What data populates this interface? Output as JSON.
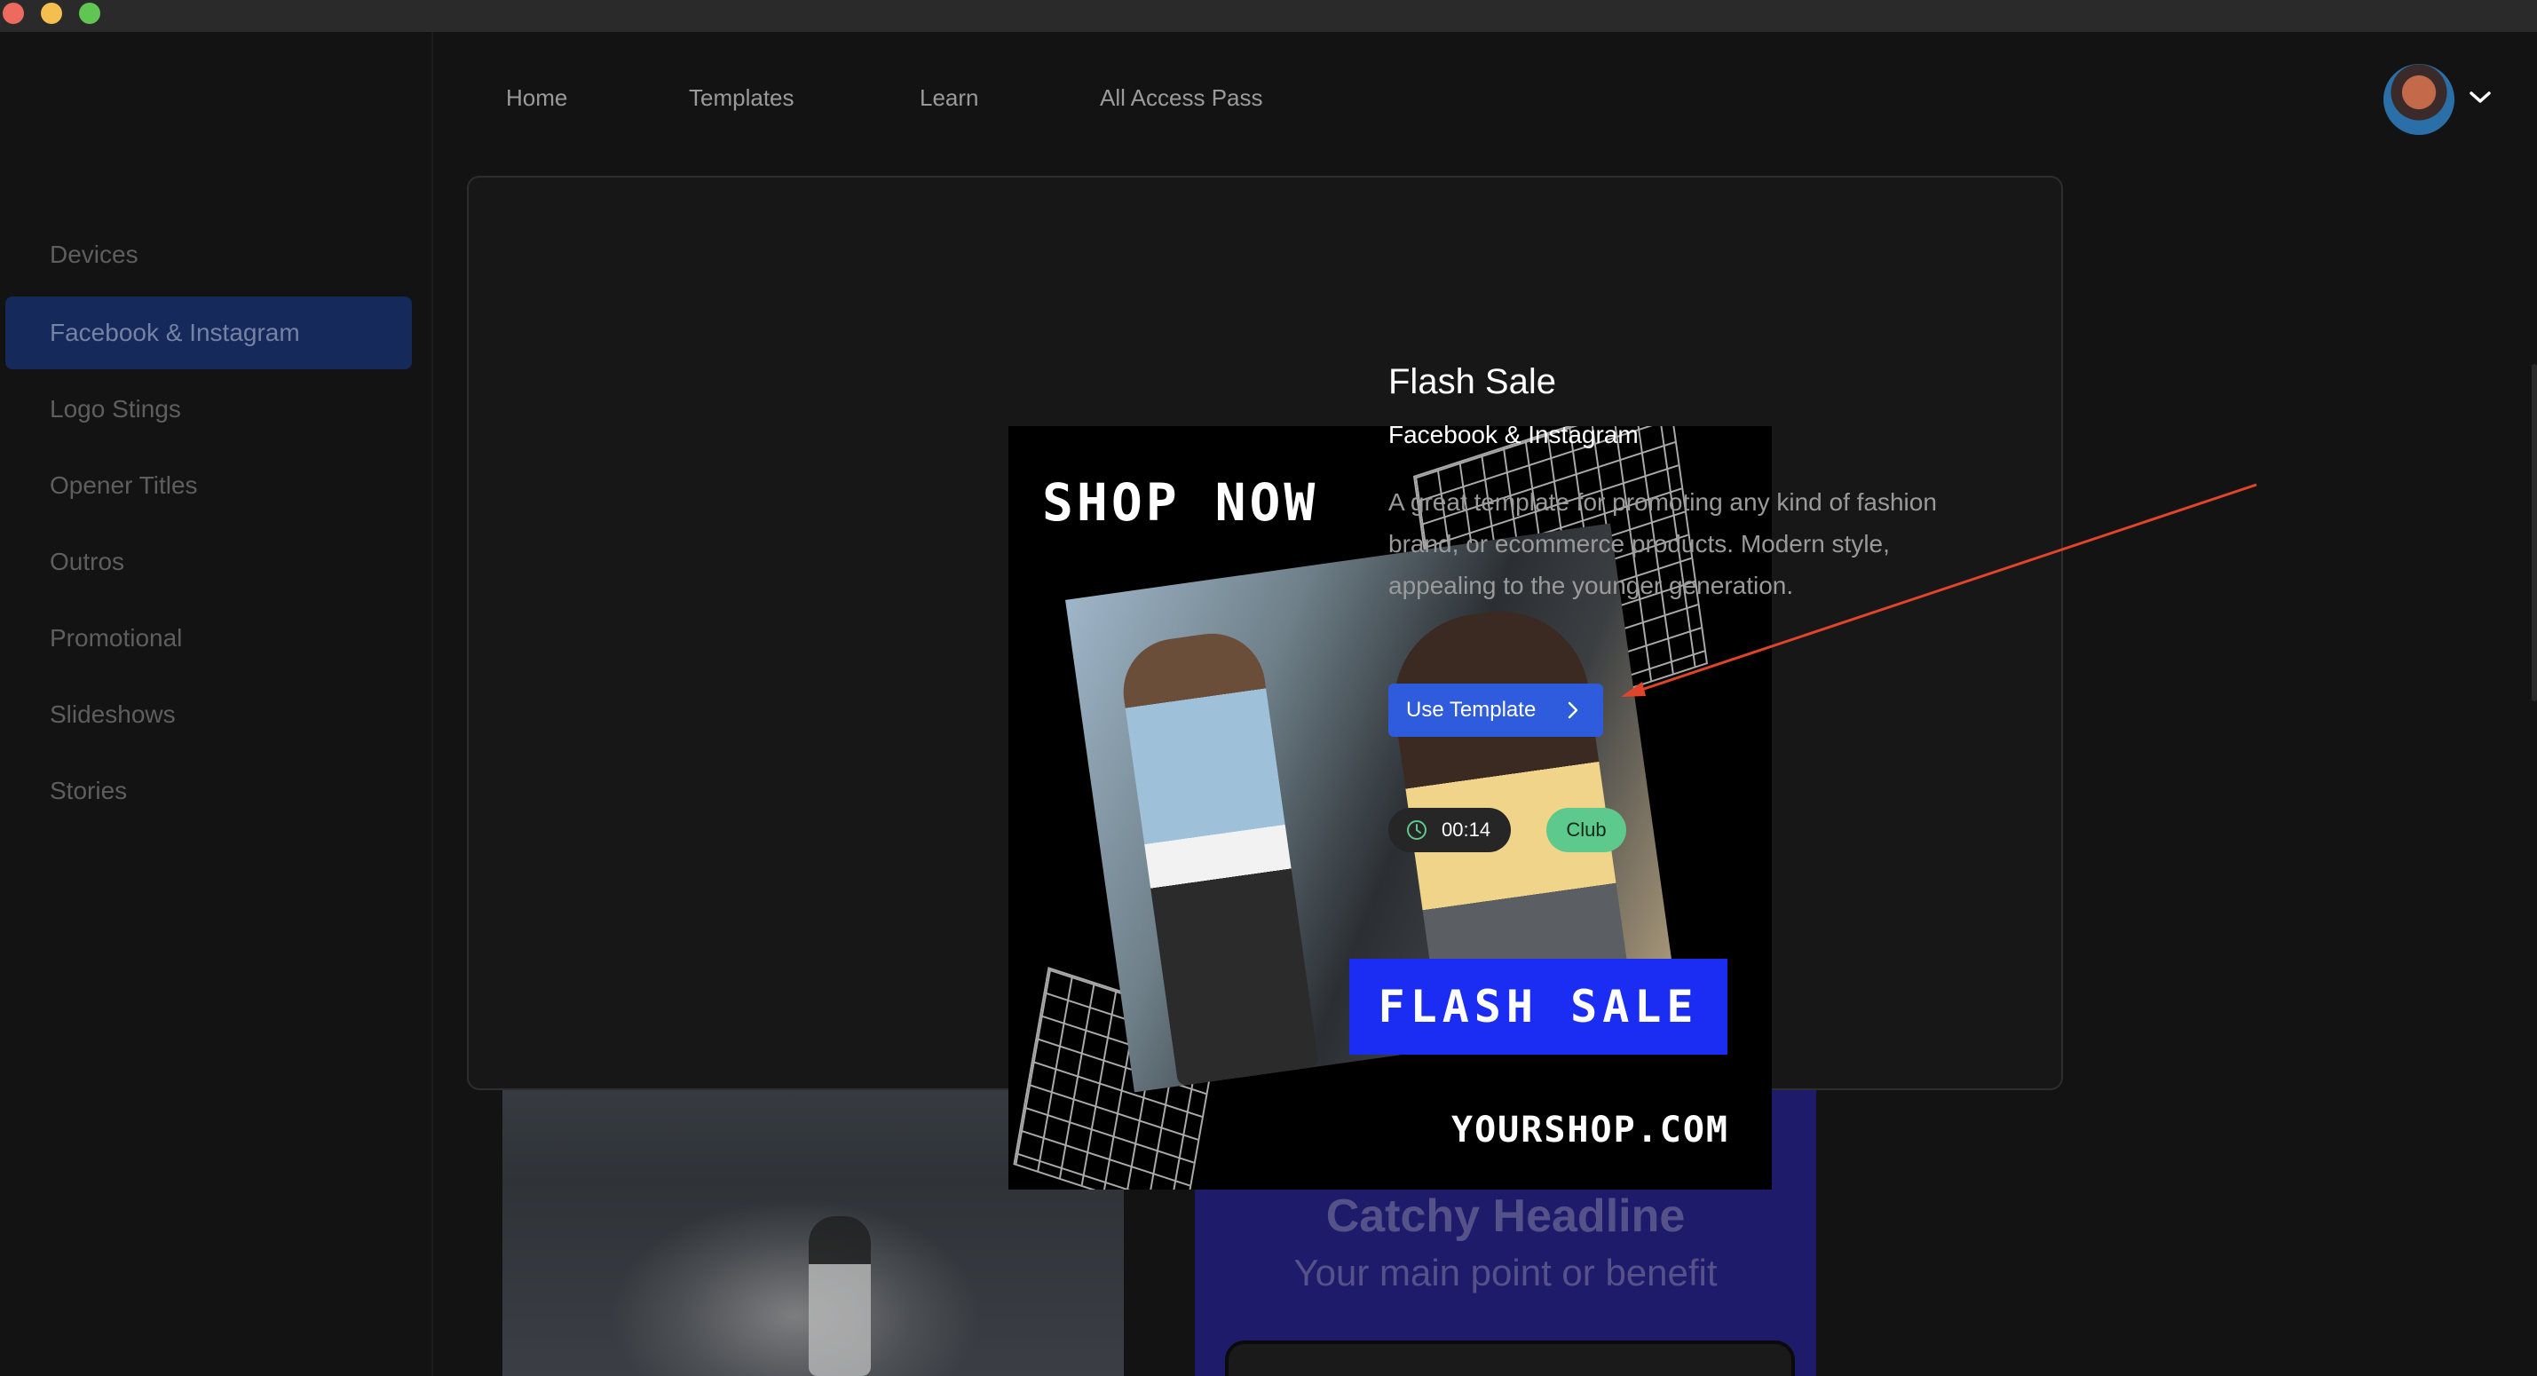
{
  "window": {
    "traffic_lights": [
      "close",
      "minimize",
      "zoom"
    ]
  },
  "top_nav": {
    "items": [
      "Home",
      "Templates",
      "Learn",
      "All Access Pass"
    ]
  },
  "user": {
    "avatar_icon": "avatar-icon",
    "menu_icon": "chevron-down-icon"
  },
  "sidebar": {
    "items": [
      {
        "label": "Devices",
        "active": false
      },
      {
        "label": "Facebook & Instagram",
        "active": true
      },
      {
        "label": "Logo Stings",
        "active": false
      },
      {
        "label": "Opener Titles",
        "active": false
      },
      {
        "label": "Outros",
        "active": false
      },
      {
        "label": "Promotional",
        "active": false
      },
      {
        "label": "Slideshows",
        "active": false
      },
      {
        "label": "Stories",
        "active": false
      }
    ]
  },
  "modal": {
    "preview": {
      "headline": "SHOP NOW",
      "banner": "FLASH SALE",
      "url": "YOURSHOP.COM"
    },
    "title": "Flash Sale",
    "category": "Facebook & Instagram",
    "description": "A great template for promoting any kind of fashion brand, or ecommerce products. Modern style, appealing to the younger generation.",
    "use_button": "Use Template",
    "duration": "00:14",
    "tier_badge": "Club"
  },
  "background_cards": {
    "right_headline": "Catchy Headline",
    "right_subline": "Your main point or benefit"
  },
  "colors": {
    "accent": "#2f5cdc",
    "sidebar_active": "#15295b",
    "club_badge": "#5ec98c",
    "annotation_arrow": "#e0452c"
  }
}
